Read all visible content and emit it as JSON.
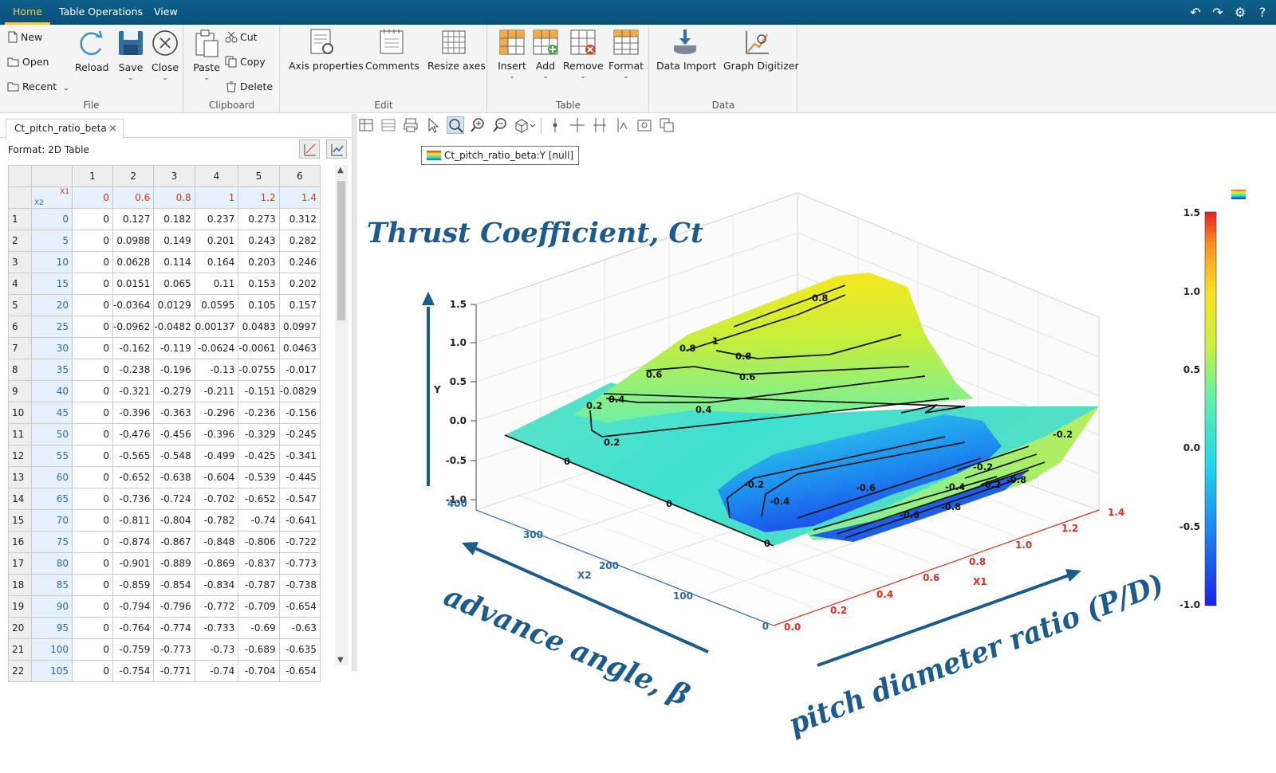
{
  "menu": {
    "tabs": [
      "Home",
      "Table Operations",
      "View"
    ],
    "active": "Home"
  },
  "ribbon": {
    "file": {
      "label": "File",
      "new": "New",
      "open": "Open",
      "recent": "Recent",
      "reload": "Reload",
      "save": "Save",
      "close": "Close"
    },
    "clipboard": {
      "label": "Clipboard",
      "paste": "Paste",
      "cut": "Cut",
      "copy": "Copy",
      "delete": "Delete"
    },
    "edit": {
      "label": "Edit",
      "axis_properties": "Axis properties",
      "comments": "Comments",
      "resize_axes": "Resize axes"
    },
    "table": {
      "label": "Table",
      "insert": "Insert",
      "add": "Add",
      "remove": "Remove",
      "format": "Format"
    },
    "data": {
      "label": "Data",
      "data_import": "Data Import",
      "graph_digitizer": "Graph Digitizer"
    }
  },
  "document": {
    "tab_title": "Ct_pitch_ratio_beta",
    "format_label": "Format: 2D Table"
  },
  "table": {
    "col_headers": [
      "1",
      "2",
      "3",
      "4",
      "5",
      "6"
    ],
    "x1_label": "X1",
    "x2_label": "X2",
    "x1_values": [
      "0",
      "0.6",
      "0.8",
      "1",
      "1.2",
      "1.4"
    ],
    "rows": [
      {
        "n": "1",
        "x2": "0",
        "v": [
          "0",
          "0.127",
          "0.182",
          "0.237",
          "0.273",
          "0.312"
        ]
      },
      {
        "n": "2",
        "x2": "5",
        "v": [
          "0",
          "0.0988",
          "0.149",
          "0.201",
          "0.243",
          "0.282"
        ]
      },
      {
        "n": "3",
        "x2": "10",
        "v": [
          "0",
          "0.0628",
          "0.114",
          "0.164",
          "0.203",
          "0.246"
        ]
      },
      {
        "n": "4",
        "x2": "15",
        "v": [
          "0",
          "0.0151",
          "0.065",
          "0.11",
          "0.153",
          "0.202"
        ]
      },
      {
        "n": "5",
        "x2": "20",
        "v": [
          "0",
          "-0.0364",
          "0.0129",
          "0.0595",
          "0.105",
          "0.157"
        ]
      },
      {
        "n": "6",
        "x2": "25",
        "v": [
          "0",
          "-0.0962",
          "-0.0482",
          "0.00137",
          "0.0483",
          "0.0997"
        ]
      },
      {
        "n": "7",
        "x2": "30",
        "v": [
          "0",
          "-0.162",
          "-0.119",
          "-0.0624",
          "-0.0061",
          "0.0463"
        ]
      },
      {
        "n": "8",
        "x2": "35",
        "v": [
          "0",
          "-0.238",
          "-0.196",
          "-0.13",
          "-0.0755",
          "-0.017"
        ]
      },
      {
        "n": "9",
        "x2": "40",
        "v": [
          "0",
          "-0.321",
          "-0.279",
          "-0.211",
          "-0.151",
          "-0.0829"
        ]
      },
      {
        "n": "10",
        "x2": "45",
        "v": [
          "0",
          "-0.396",
          "-0.363",
          "-0.296",
          "-0.236",
          "-0.156"
        ]
      },
      {
        "n": "11",
        "x2": "50",
        "v": [
          "0",
          "-0.476",
          "-0.456",
          "-0.396",
          "-0.329",
          "-0.245"
        ]
      },
      {
        "n": "12",
        "x2": "55",
        "v": [
          "0",
          "-0.565",
          "-0.548",
          "-0.499",
          "-0.425",
          "-0.341"
        ]
      },
      {
        "n": "13",
        "x2": "60",
        "v": [
          "0",
          "-0.652",
          "-0.638",
          "-0.604",
          "-0.539",
          "-0.445"
        ]
      },
      {
        "n": "14",
        "x2": "65",
        "v": [
          "0",
          "-0.736",
          "-0.724",
          "-0.702",
          "-0.652",
          "-0.547"
        ]
      },
      {
        "n": "15",
        "x2": "70",
        "v": [
          "0",
          "-0.811",
          "-0.804",
          "-0.782",
          "-0.74",
          "-0.641"
        ]
      },
      {
        "n": "16",
        "x2": "75",
        "v": [
          "0",
          "-0.874",
          "-0.867",
          "-0.848",
          "-0.806",
          "-0.722"
        ]
      },
      {
        "n": "17",
        "x2": "80",
        "v": [
          "0",
          "-0.901",
          "-0.889",
          "-0.869",
          "-0.837",
          "-0.773"
        ]
      },
      {
        "n": "18",
        "x2": "85",
        "v": [
          "0",
          "-0.859",
          "-0.854",
          "-0.834",
          "-0.787",
          "-0.738"
        ]
      },
      {
        "n": "19",
        "x2": "90",
        "v": [
          "0",
          "-0.794",
          "-0.796",
          "-0.772",
          "-0.709",
          "-0.654"
        ]
      },
      {
        "n": "20",
        "x2": "95",
        "v": [
          "0",
          "-0.764",
          "-0.774",
          "-0.733",
          "-0.69",
          "-0.63"
        ]
      },
      {
        "n": "21",
        "x2": "100",
        "v": [
          "0",
          "-0.759",
          "-0.773",
          "-0.73",
          "-0.689",
          "-0.635"
        ]
      },
      {
        "n": "22",
        "x2": "105",
        "v": [
          "0",
          "-0.754",
          "-0.771",
          "-0.74",
          "-0.704",
          "-0.654"
        ]
      }
    ]
  },
  "graph": {
    "legend_text": "Ct_pitch_ratio_beta:Y [null]",
    "title": "Thrust Coefficient, Ct",
    "y_label": "Y",
    "x1_label": "X1",
    "x2_label": "X2",
    "y_ticks": [
      "1.5",
      "1.0",
      "0.5",
      "0.0",
      "-0.5",
      "-1.0"
    ],
    "x1_ticks": [
      "0.0",
      "0.2",
      "0.4",
      "0.6",
      "0.8",
      "1.0",
      "1.2",
      "1.4"
    ],
    "x2_ticks": [
      "0",
      "100",
      "200",
      "300",
      "400"
    ],
    "colorbar_ticks": [
      "1.5",
      "1.0",
      "0.5",
      "0.0",
      "-0.5",
      "-1.0"
    ],
    "contour_labels": [
      "0.8",
      "1",
      "0.8",
      "0.8",
      "0.6",
      "0.6",
      "0.4",
      "0.4",
      "0.2",
      "0.2",
      "0",
      "0",
      "0",
      "-0.2",
      "-0.4",
      "-0.6",
      "-0.6",
      "-0.4",
      "-0.8",
      "-0.8",
      "-0.2",
      "-0.2",
      "-0.2"
    ],
    "annotation_advance": "advance angle, β",
    "annotation_pitch": "pitch diameter ratio (P/D)",
    "colors": {
      "annotation": "#1d5b8c",
      "x1_axis": "#d9301f",
      "x2_axis": "#2b6aa6"
    }
  }
}
